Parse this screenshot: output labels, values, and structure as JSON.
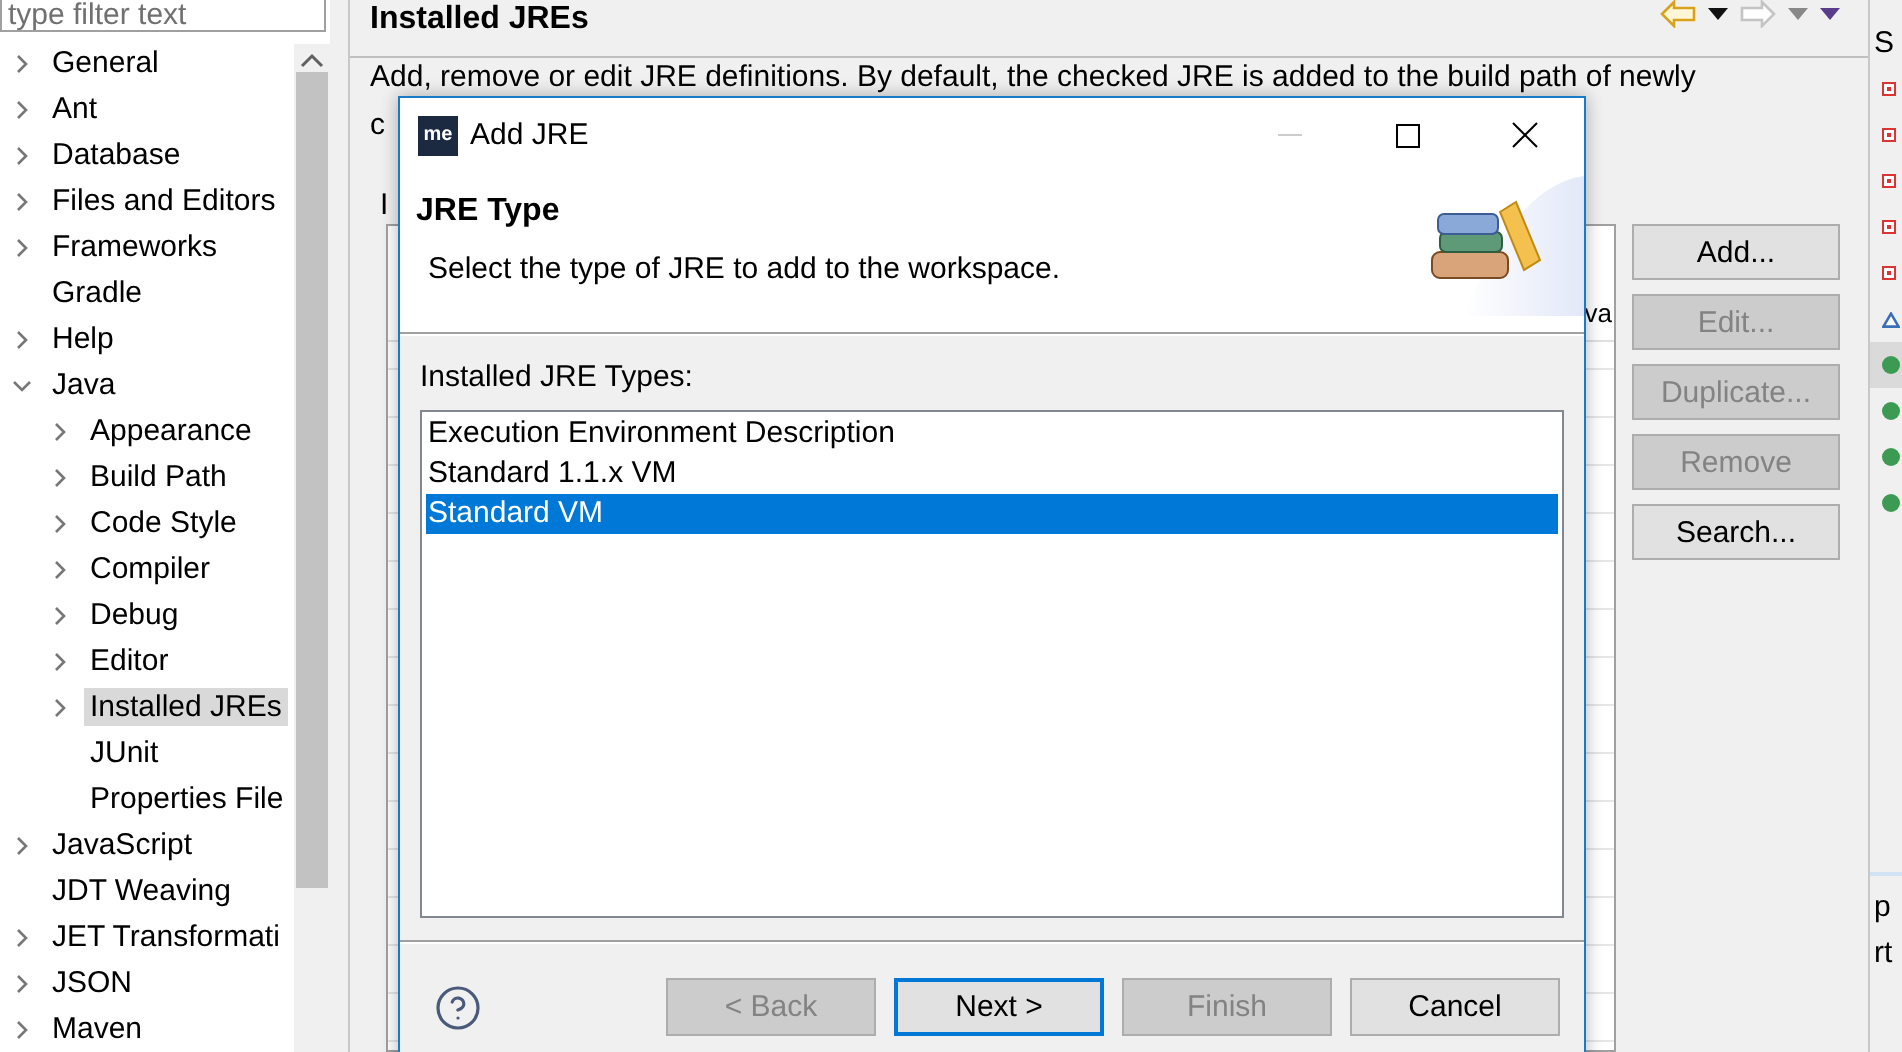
{
  "filter": {
    "placeholder": "type filter text"
  },
  "tree": [
    {
      "label": "General",
      "kind": "folder",
      "expanded": false,
      "selected": false
    },
    {
      "label": "Ant",
      "kind": "folder",
      "expanded": false,
      "selected": false
    },
    {
      "label": "Database",
      "kind": "folder",
      "expanded": false,
      "selected": false
    },
    {
      "label": "Files and Editors",
      "kind": "folder",
      "expanded": false,
      "selected": false
    },
    {
      "label": "Frameworks",
      "kind": "folder",
      "expanded": false,
      "selected": false
    },
    {
      "label": "Gradle",
      "kind": "leaf",
      "selected": false
    },
    {
      "label": "Help",
      "kind": "folder",
      "expanded": false,
      "selected": false
    },
    {
      "label": "Java",
      "kind": "folder",
      "expanded": true,
      "selected": false,
      "children": [
        {
          "label": "Appearance",
          "kind": "folder",
          "expanded": false,
          "selected": false
        },
        {
          "label": "Build Path",
          "kind": "folder",
          "expanded": false,
          "selected": false
        },
        {
          "label": "Code Style",
          "kind": "folder",
          "expanded": false,
          "selected": false
        },
        {
          "label": "Compiler",
          "kind": "folder",
          "expanded": false,
          "selected": false
        },
        {
          "label": "Debug",
          "kind": "folder",
          "expanded": false,
          "selected": false
        },
        {
          "label": "Editor",
          "kind": "folder",
          "expanded": false,
          "selected": false
        },
        {
          "label": "Installed JREs",
          "kind": "folder",
          "expanded": false,
          "selected": true
        },
        {
          "label": "JUnit",
          "kind": "leaf",
          "selected": false
        },
        {
          "label": "Properties File",
          "kind": "leaf",
          "selected": false
        }
      ]
    },
    {
      "label": "JavaScript",
      "kind": "folder",
      "expanded": false,
      "selected": false
    },
    {
      "label": "JDT Weaving",
      "kind": "leaf",
      "selected": false
    },
    {
      "label": "JET Transformati",
      "kind": "folder",
      "expanded": false,
      "selected": false
    },
    {
      "label": "JSON",
      "kind": "folder",
      "expanded": false,
      "selected": false
    },
    {
      "label": "Maven",
      "kind": "folder",
      "expanded": false,
      "selected": false
    }
  ],
  "page": {
    "title": "Installed JREs",
    "description_lines": [
      "Add, remove or edit JRE definitions. By default, the checked JRE is added to the build path of newly",
      "c"
    ],
    "table_label": "I",
    "table_column_header": "va",
    "buttons": [
      {
        "label": "Add...",
        "disabled": false
      },
      {
        "label": "Edit...",
        "disabled": true
      },
      {
        "label": "Duplicate...",
        "disabled": true
      },
      {
        "label": "Remove",
        "disabled": true
      },
      {
        "label": "Search...",
        "disabled": false
      }
    ]
  },
  "side_strip": {
    "texts_top": [
      "S"
    ],
    "markers": [
      {
        "kind": "error"
      },
      {
        "kind": "error"
      },
      {
        "kind": "error"
      },
      {
        "kind": "error"
      },
      {
        "kind": "error"
      },
      {
        "kind": "warning"
      },
      {
        "kind": "ok"
      },
      {
        "kind": "ok"
      },
      {
        "kind": "ok"
      },
      {
        "kind": "ok"
      }
    ],
    "texts_bottom": [
      "p",
      "rt"
    ]
  },
  "dialog": {
    "app_icon_text": "me",
    "title": "Add JRE",
    "heading": "JRE Type",
    "message": "Select the type of JRE to add to the workspace.",
    "list_label": "Installed JRE Types:",
    "items": [
      {
        "label": "Execution Environment Description",
        "selected": false
      },
      {
        "label": "Standard 1.1.x VM",
        "selected": false
      },
      {
        "label": "Standard VM",
        "selected": true
      }
    ],
    "buttons": [
      {
        "label": "< Back",
        "disabled": true,
        "default": false
      },
      {
        "label": "Next >",
        "disabled": false,
        "default": true
      },
      {
        "label": "Finish",
        "disabled": true,
        "default": false
      },
      {
        "label": "Cancel",
        "disabled": false,
        "default": false
      }
    ]
  }
}
